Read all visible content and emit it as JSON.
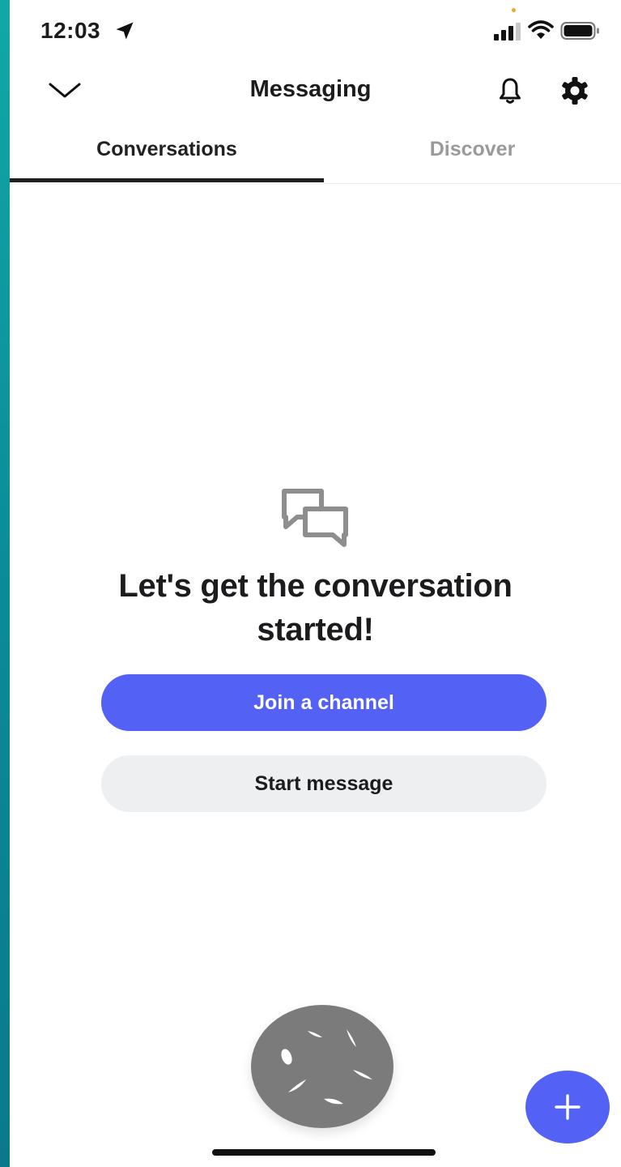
{
  "status_bar": {
    "time": "12:03",
    "icons": [
      "location-arrow-icon",
      "signal-icon",
      "wifi-icon",
      "battery-icon"
    ]
  },
  "header": {
    "title": "Messaging",
    "icons": [
      "chevron-down-icon",
      "bell-icon",
      "gear-icon"
    ]
  },
  "tabs": [
    {
      "label": "Conversations",
      "active": true
    },
    {
      "label": "Discover",
      "active": false
    }
  ],
  "empty_state": {
    "icon": "chat-bubbles-icon",
    "title": "Let's get the conversation started!",
    "primary_button": "Join a channel",
    "secondary_button": "Start message"
  },
  "floating": {
    "assistive_icon": "assistive-touch-icon",
    "fab_icon": "plus-icon"
  },
  "colors": {
    "accent": "#5361f5",
    "secondary_button_bg": "#eeeff1",
    "inactive_tab": "#9a9a9a",
    "side_strip": "#0b8b98"
  }
}
